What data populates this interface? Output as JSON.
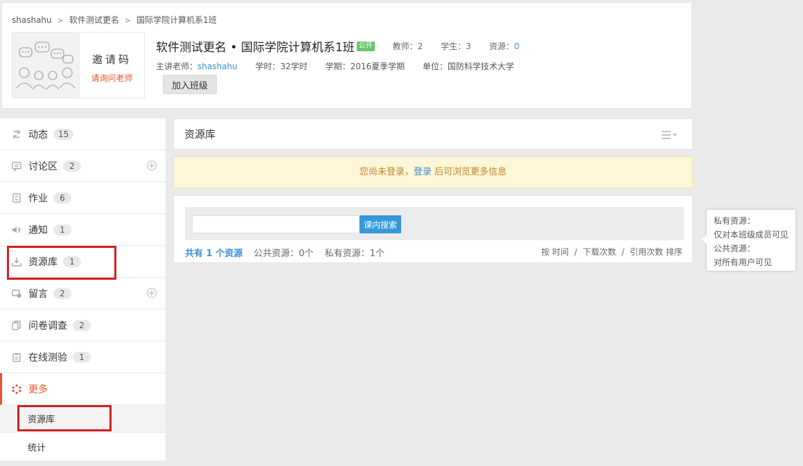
{
  "breadcrumb": {
    "user": "shashahu",
    "course": "软件测试更名",
    "class": "国际学院计算机系1班",
    "sep": ">"
  },
  "invite": {
    "title": "邀请码",
    "subtitle": "请询问老师"
  },
  "course": {
    "title": "软件测试更名 • 国际学院计算机系1班",
    "badge": "公开",
    "teachers": "教师：2",
    "students": "学生：3",
    "resources_label": "资源：",
    "resources_value": "0",
    "lead_teacher_label": "主讲老师：",
    "lead_teacher": "shashahu",
    "hours": "学时：32学时",
    "term": "学期：2016夏季学期",
    "unit": "单位：国防科学技术大学",
    "join_button": "加入班级"
  },
  "sidebar": {
    "items": [
      {
        "label": "动态",
        "count": "15",
        "icon": "refresh-icon"
      },
      {
        "label": "讨论区",
        "count": "2",
        "icon": "comment-icon",
        "plus": true
      },
      {
        "label": "作业",
        "count": "6",
        "icon": "homework-icon"
      },
      {
        "label": "通知",
        "count": "1",
        "icon": "speaker-icon"
      },
      {
        "label": "资源库",
        "count": "1",
        "icon": "download-icon"
      },
      {
        "label": "留言",
        "count": "2",
        "icon": "message-icon",
        "plus": true
      },
      {
        "label": "问卷调查",
        "count": "2",
        "icon": "copy-icon"
      },
      {
        "label": "在线测验",
        "count": "1",
        "icon": "clipboard-icon"
      }
    ],
    "more": {
      "label": "更多",
      "icon": "dots-circle-icon",
      "color": "#e9532f"
    },
    "sub_items": [
      "资源库",
      "统计"
    ]
  },
  "panel": {
    "title": "资源库",
    "menu_icon": "list-menu-icon"
  },
  "notice": {
    "prefix": "您尚未登录，",
    "link": "登录",
    "suffix": " 后可浏览更多信息"
  },
  "search": {
    "placeholder": "",
    "button": "课内搜索"
  },
  "summary": {
    "total": "共有 1 个资源",
    "public": "公共资源：0个",
    "private": "私有资源：1个"
  },
  "sort": {
    "by": "按",
    "time": "时间",
    "downloads": "下载次数",
    "references": "引用次数",
    "order": "排序",
    "slash": "/"
  },
  "tooltip": {
    "private_title": "私有资源：",
    "private_desc": "仅对本班级成员可见",
    "public_title": "公共资源：",
    "public_desc": "对所有用户可见"
  },
  "colors": {
    "accent": "#e9532f",
    "link": "#3b8fd4",
    "highlight_box": "#d41f1f"
  }
}
